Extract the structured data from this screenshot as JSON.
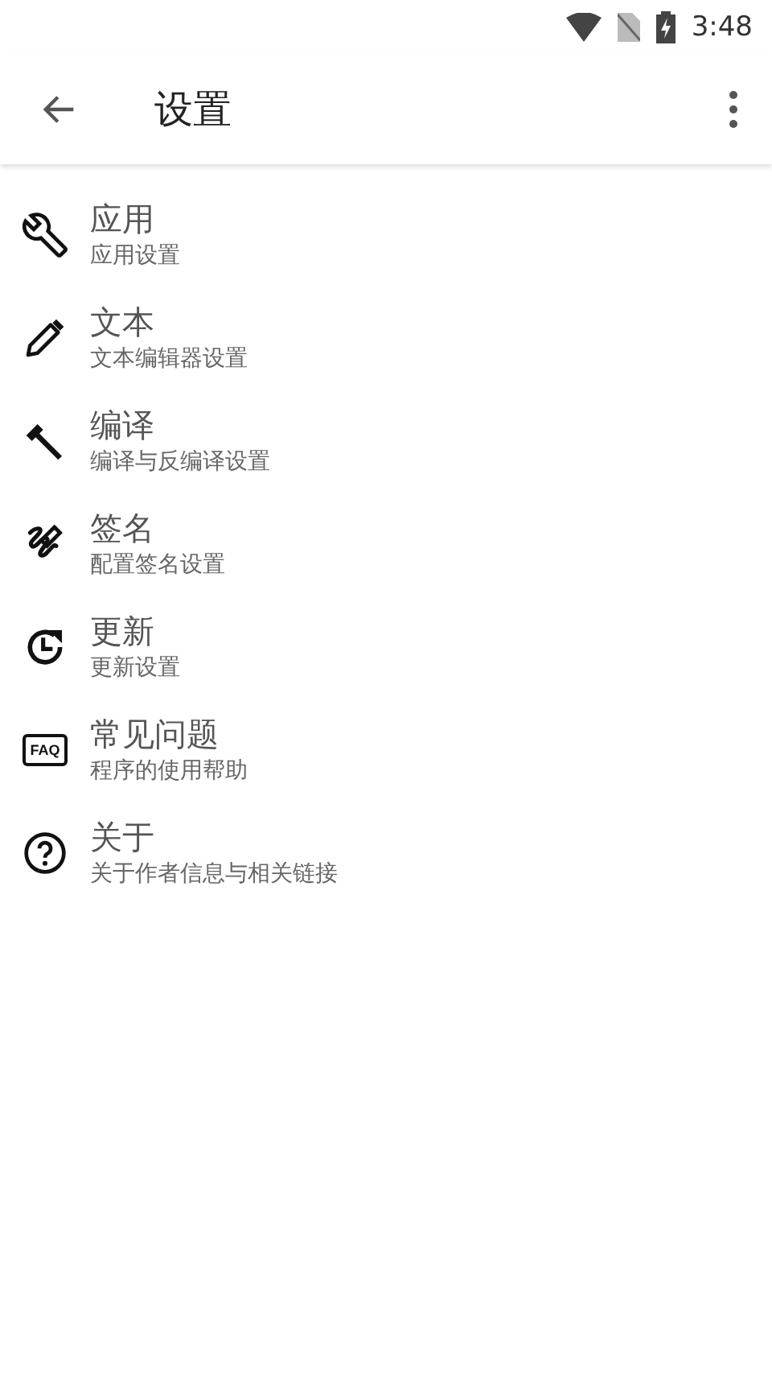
{
  "status_bar": {
    "time": "3:48"
  },
  "toolbar": {
    "title": "设置"
  },
  "items": [
    {
      "kind": "wrench",
      "title": "应用",
      "subtitle": "应用设置"
    },
    {
      "kind": "pencil",
      "title": "文本",
      "subtitle": "文本编辑器设置"
    },
    {
      "kind": "hammer",
      "title": "编译",
      "subtitle": "编译与反编译设置"
    },
    {
      "kind": "signature",
      "title": "签名",
      "subtitle": "配置签名设置"
    },
    {
      "kind": "update",
      "title": "更新",
      "subtitle": "更新设置"
    },
    {
      "kind": "faq",
      "icon_text": "FAQ",
      "title": "常见问题",
      "subtitle": "程序的使用帮助"
    },
    {
      "kind": "help",
      "title": "关于",
      "subtitle": "关于作者信息与相关链接"
    }
  ]
}
